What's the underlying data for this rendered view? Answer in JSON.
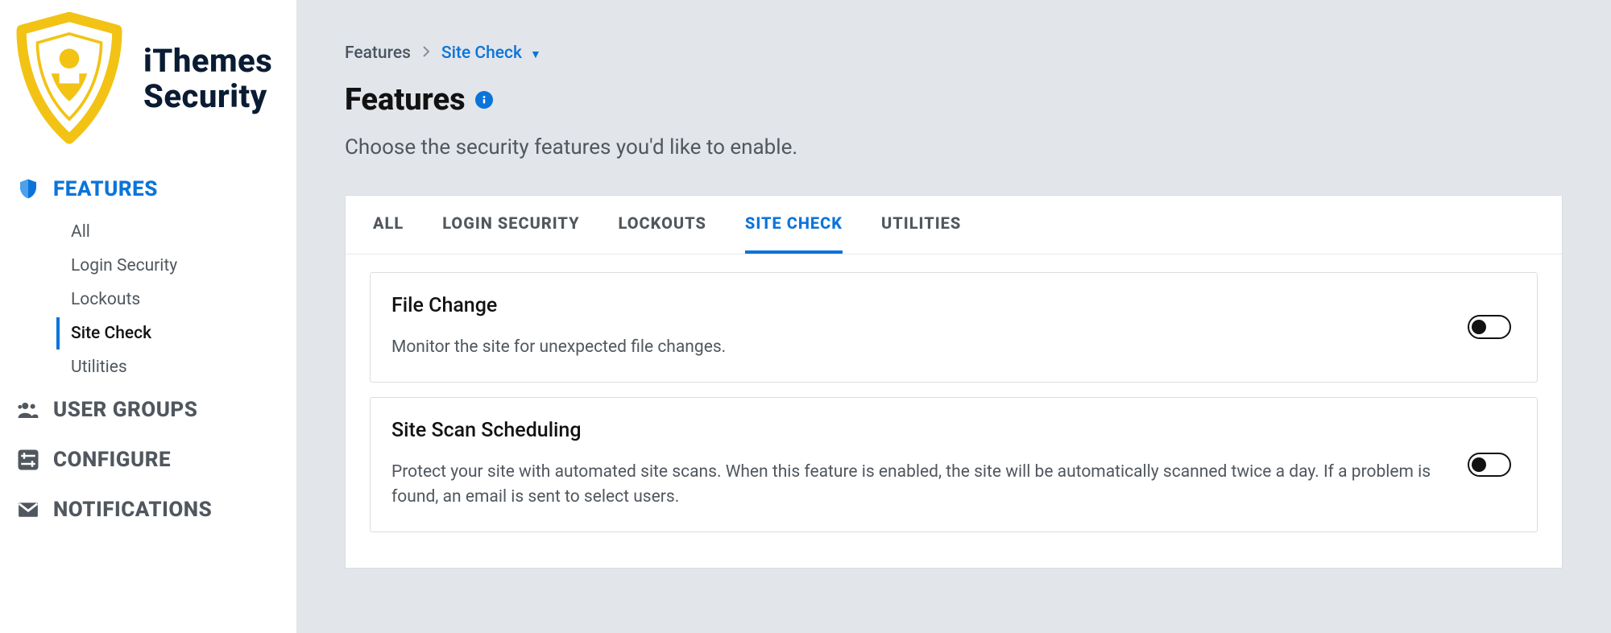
{
  "brand": {
    "name1": "iThemes",
    "name2": "Security"
  },
  "sidebar": {
    "sections": [
      {
        "label": "FEATURES",
        "icon": "shield-check"
      },
      {
        "label": "USER GROUPS",
        "icon": "people"
      },
      {
        "label": "CONFIGURE",
        "icon": "sliders"
      },
      {
        "label": "NOTIFICATIONS",
        "icon": "mail"
      }
    ],
    "features_sub": [
      {
        "label": "All"
      },
      {
        "label": "Login Security"
      },
      {
        "label": "Lockouts"
      },
      {
        "label": "Site Check"
      },
      {
        "label": "Utilities"
      }
    ]
  },
  "breadcrumb": {
    "root": "Features",
    "leaf": "Site Check"
  },
  "page": {
    "title": "Features",
    "description": "Choose the security features you'd like to enable."
  },
  "tabs": [
    {
      "label": "ALL"
    },
    {
      "label": "LOGIN SECURITY"
    },
    {
      "label": "LOCKOUTS"
    },
    {
      "label": "SITE CHECK"
    },
    {
      "label": "UTILITIES"
    }
  ],
  "features": [
    {
      "title": "File Change",
      "desc": "Monitor the site for unexpected file changes."
    },
    {
      "title": "Site Scan Scheduling",
      "desc": "Protect your site with automated site scans. When this feature is enabled, the site will be automatically scanned twice a day. If a problem is found, an email is sent to select users."
    }
  ]
}
